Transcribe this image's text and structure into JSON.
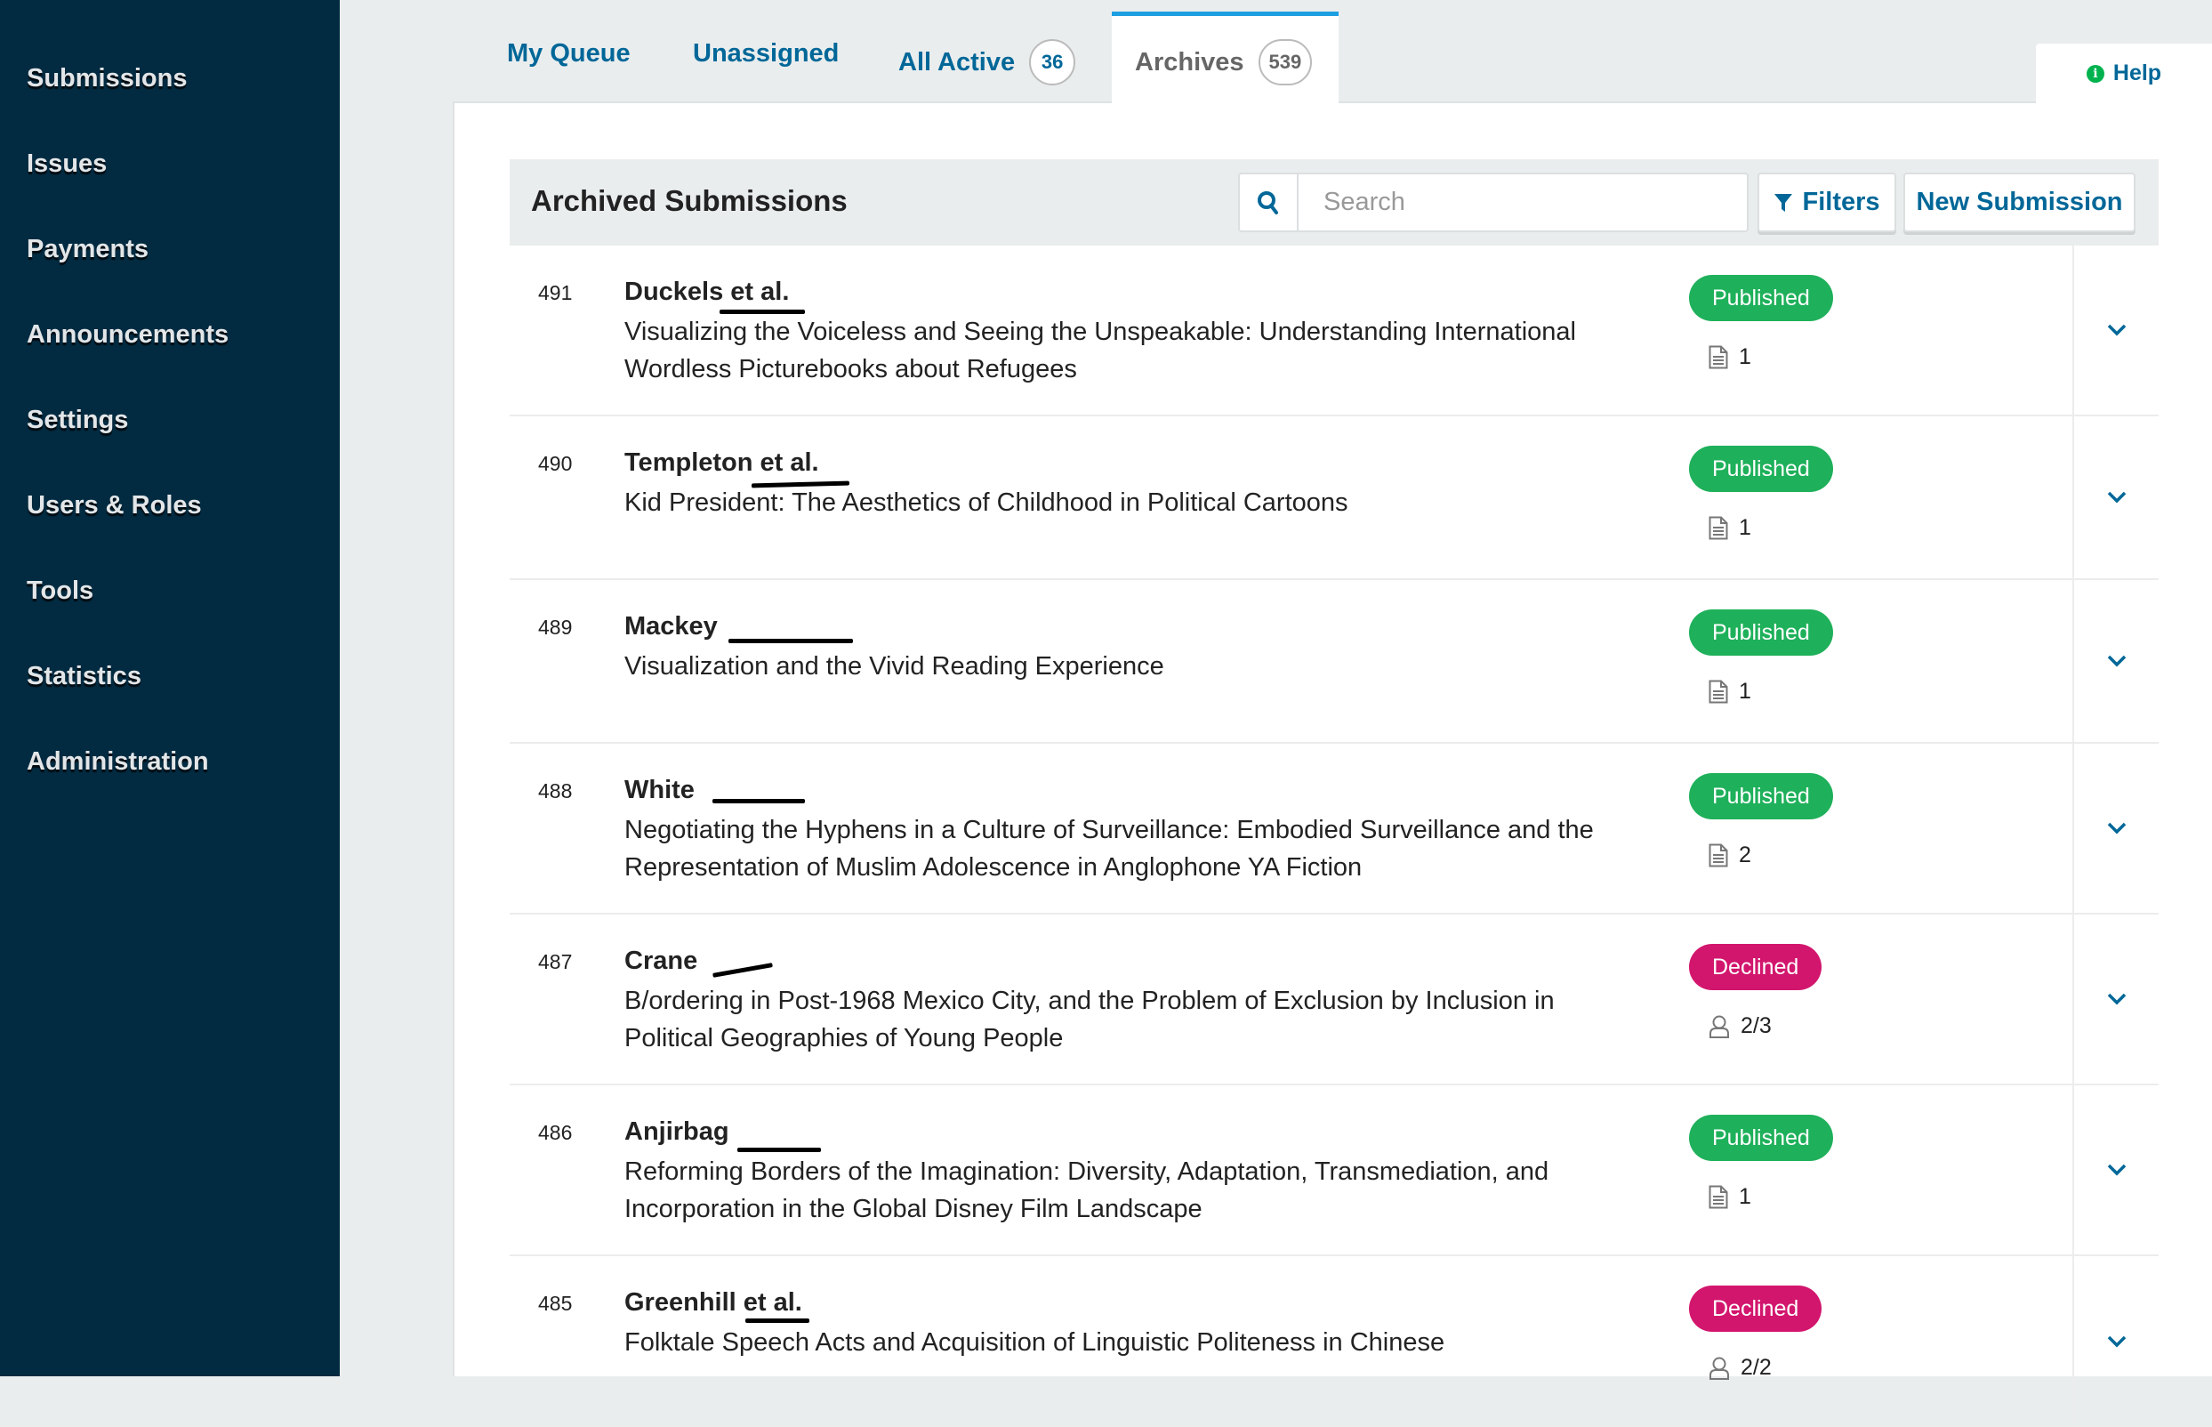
{
  "sidebar": {
    "items": [
      {
        "label": "Submissions"
      },
      {
        "label": "Issues"
      },
      {
        "label": "Payments"
      },
      {
        "label": "Announcements"
      },
      {
        "label": "Settings"
      },
      {
        "label": "Users & Roles"
      },
      {
        "label": "Tools"
      },
      {
        "label": "Statistics"
      },
      {
        "label": "Administration"
      }
    ]
  },
  "tabs": [
    {
      "label": "My Queue"
    },
    {
      "label": "Unassigned"
    },
    {
      "label": "All Active",
      "count": "36"
    },
    {
      "label": "Archives",
      "count": "539",
      "active": true
    }
  ],
  "help": {
    "label": "Help"
  },
  "list": {
    "title": "Archived Submissions",
    "search_placeholder": "Search",
    "search_value": "",
    "filters_label": "Filters",
    "new_submission_label": "New Submission"
  },
  "colors": {
    "sidebar_bg": "#022b41",
    "link": "#006798",
    "active_tab_border": "#1e9fe2",
    "published": "#1eb05a",
    "declined": "#d2166d"
  },
  "submissions": [
    {
      "id": "491",
      "author": "Duckels et al.",
      "title": "Visualizing the Voiceless and Seeing the Unspeakable: Understanding International Wordless Picturebooks about Refugees",
      "status": "Published",
      "meta_icon": "file-icon",
      "meta_value": "1"
    },
    {
      "id": "490",
      "author": "Templeton et al.",
      "title": "Kid President: The Aesthetics of Childhood in Political Cartoons",
      "status": "Published",
      "meta_icon": "file-icon",
      "meta_value": "1"
    },
    {
      "id": "489",
      "author": "Mackey",
      "title": "Visualization and the Vivid Reading Experience",
      "status": "Published",
      "meta_icon": "file-icon",
      "meta_value": "1"
    },
    {
      "id": "488",
      "author": "White",
      "title": "Negotiating the Hyphens in a Culture of Surveillance: Embodied Surveillance and the Representation of Muslim Adolescence in Anglophone YA Fiction",
      "status": "Published",
      "meta_icon": "file-icon",
      "meta_value": "2"
    },
    {
      "id": "487",
      "author": "Crane",
      "title": "B/ordering in Post-1968 Mexico City, and the Problem of Exclusion by Inclusion in Political Geographies of Young People",
      "status": "Declined",
      "meta_icon": "user-icon",
      "meta_value": "2/3"
    },
    {
      "id": "486",
      "author": "Anjirbag",
      "title": "Reforming Borders of the Imagination: Diversity, Adaptation, Transmediation, and Incorporation in the Global Disney Film Landscape",
      "status": "Published",
      "meta_icon": "file-icon",
      "meta_value": "1"
    },
    {
      "id": "485",
      "author": "Greenhill et al.",
      "title": "Folktale Speech Acts and Acquisition of Linguistic Politeness in Chinese",
      "status": "Declined",
      "meta_icon": "user-icon",
      "meta_value": "2/2"
    }
  ]
}
